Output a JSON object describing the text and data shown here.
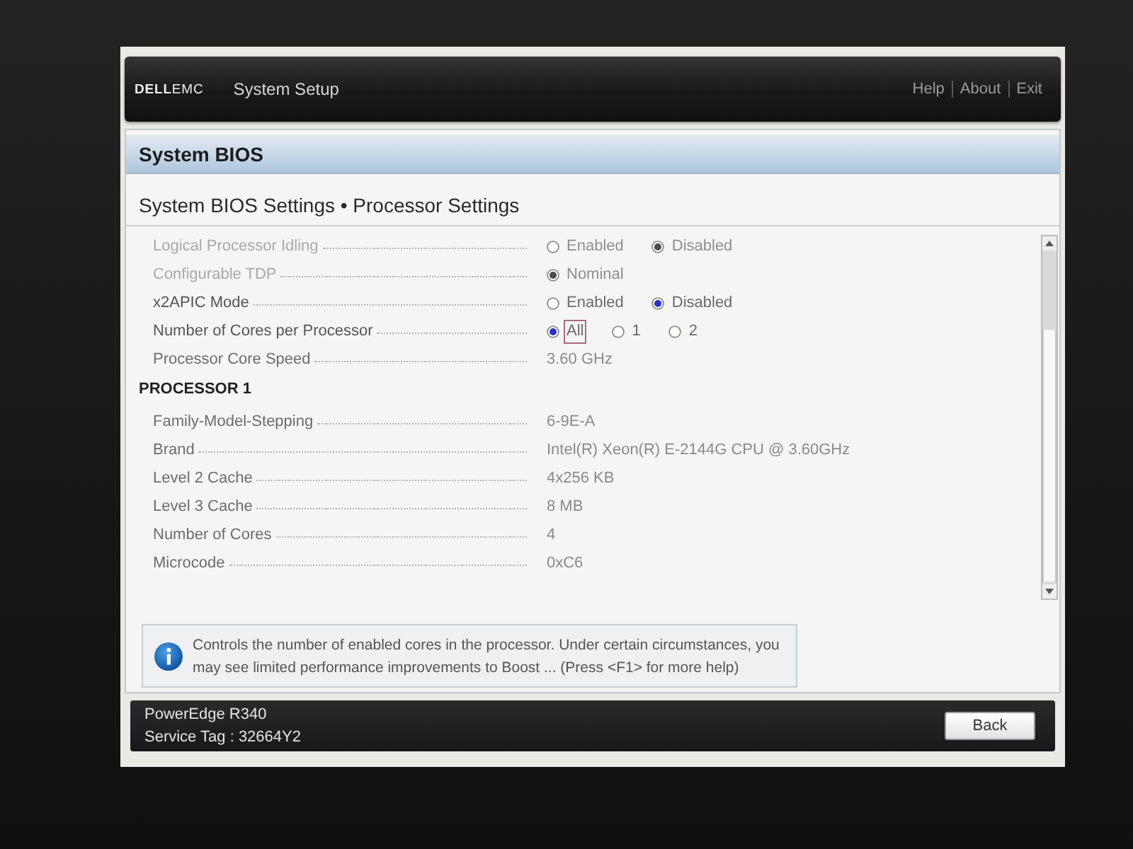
{
  "header": {
    "logo": "**DELL**EMC",
    "title": "System Setup",
    "links": [
      "Help",
      "About",
      "Exit"
    ]
  },
  "page_title": "System BIOS",
  "breadcrumb": "System BIOS Settings • Processor Settings",
  "rows": [
    {
      "kind": "radio",
      "label": "Logical Processor Idling",
      "disabled": true,
      "options": [
        {
          "label": "Enabled",
          "selected": false,
          "focused": false
        },
        {
          "label": "Disabled",
          "selected": true,
          "focused": false
        }
      ]
    },
    {
      "kind": "radio",
      "label": "Configurable TDP",
      "disabled": true,
      "options": [
        {
          "label": "Nominal",
          "selected": true,
          "focused": false
        }
      ]
    },
    {
      "kind": "radio",
      "label": "x2APIC Mode",
      "disabled": false,
      "options": [
        {
          "label": "Enabled",
          "selected": false,
          "focused": false
        },
        {
          "label": "Disabled",
          "selected": true,
          "focused": false
        }
      ]
    },
    {
      "kind": "radio",
      "label": "Number of Cores per Processor",
      "disabled": false,
      "options": [
        {
          "label": "All",
          "selected": true,
          "focused": true
        },
        {
          "label": "1",
          "selected": false,
          "focused": false
        },
        {
          "label": "2",
          "selected": false,
          "focused": false
        }
      ]
    },
    {
      "kind": "value",
      "label": "Processor Core Speed",
      "value": "3.60 GHz"
    },
    {
      "kind": "heading",
      "label": "PROCESSOR 1"
    },
    {
      "kind": "value",
      "label": "Family-Model-Stepping",
      "value": "6-9E-A"
    },
    {
      "kind": "value",
      "label": "Brand",
      "value": "Intel(R) Xeon(R) E-2144G CPU @ 3.60GHz"
    },
    {
      "kind": "value",
      "label": "Level 2 Cache",
      "value": "4x256 KB"
    },
    {
      "kind": "value",
      "label": "Level 3 Cache",
      "value": "8 MB"
    },
    {
      "kind": "value",
      "label": "Number of Cores",
      "value": "4"
    },
    {
      "kind": "value",
      "label": "Microcode",
      "value": "0xC6"
    }
  ],
  "help_text": "Controls the number of enabled cores in the processor. Under certain circumstances, you may see limited performance improvements to Boost ... (Press <F1> for more help)",
  "footer": {
    "model": "PowerEdge R340",
    "service_tag": "Service Tag : 32664Y2",
    "button": "Back"
  }
}
